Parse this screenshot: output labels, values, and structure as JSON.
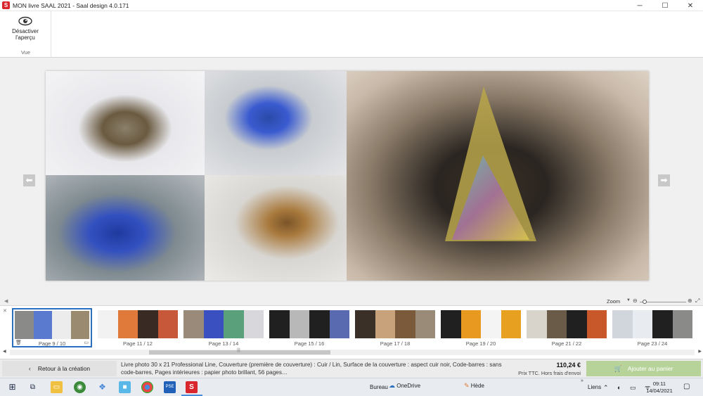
{
  "window": {
    "logo_letter": "S",
    "title": "MON livre SAAL 2021 - Saal design 4.0.171",
    "minimize": "─",
    "maximize": "☐",
    "close": "✕"
  },
  "ribbon": {
    "preview_label_line1": "Désactiver",
    "preview_label_line2": "l'aperçu",
    "group_label": "Vue"
  },
  "canvas": {
    "prev_arrow": "⬅",
    "next_arrow": "➡"
  },
  "zoom": {
    "label": "Zoom",
    "dropdown": "▼",
    "out_icon": "⊖",
    "in_icon": "⊕",
    "fit_icon": "⤢",
    "level": 0.1
  },
  "thumbnails": [
    {
      "label": "Page 9 / 10",
      "colors": [
        "#8a8a88",
        "#5a7ad0",
        "#ececec",
        "#9a8a70"
      ],
      "selected": true
    },
    {
      "label": "Page 11 / 12",
      "colors": [
        "#f2f2f2",
        "#e07a3a",
        "#3a2a24",
        "#c8583a"
      ],
      "selected": false
    },
    {
      "label": "Page 13 / 14",
      "colors": [
        "#9a8a7a",
        "#3a50c0",
        "#5aa07a",
        "#d8d8dc"
      ],
      "selected": false
    },
    {
      "label": "Page 15 / 16",
      "colors": [
        "#202020",
        "#b8b8b8",
        "#202020",
        "#5a6ab0"
      ],
      "selected": false
    },
    {
      "label": "Page 17 / 18",
      "colors": [
        "#3a3028",
        "#c8a27a",
        "#7a5a3a",
        "#9a8a78"
      ],
      "selected": false
    },
    {
      "label": "Page 19 / 20",
      "colors": [
        "#202020",
        "#e89a20",
        "#f4f4f4",
        "#e8a020"
      ],
      "selected": false
    },
    {
      "label": "Page 21 / 22",
      "colors": [
        "#d8d4cc",
        "#6a5a48",
        "#202020",
        "#c8582a"
      ],
      "selected": false
    },
    {
      "label": "Page 23 / 24",
      "colors": [
        "#d0d6dc",
        "#e8ecf0",
        "#202020",
        "#8a8a88"
      ],
      "selected": false
    }
  ],
  "strip": {
    "close_icon": "✕",
    "delete_icon": "🗑",
    "options_icon": "▭",
    "scroll_left": "◀",
    "scroll_right": "▶",
    "scroll_grip": "|||"
  },
  "footer": {
    "back_chevron": "‹",
    "back_label": "Retour à la création",
    "description": "Livre photo 30 x 21 Professional Line, Couverture (première de couverture) : Cuir / Lin, Surface de la couverture : aspect cuir noir, Code-barres : sans code-barres, Pages intérieures : papier photo brillant, 56 pages…",
    "price": "110,24 €",
    "price_note": "Prix TTC. Hors frais d'envoi",
    "cart_icon": "🛒",
    "add_to_cart": "Ajouter au panier"
  },
  "taskbar": {
    "start": "⊞",
    "taskview": "⧉",
    "explorer": "▭",
    "tripadvisor": "◉",
    "dropbox": "❖",
    "cube": "■",
    "chrome": "",
    "pse": "PSE",
    "saal": "S",
    "bureau": "Bureau",
    "onedrive_icon": "☁",
    "onedrive": "OneDrive",
    "hede_icon": "✎",
    "hede": "Hède",
    "chevron_up": "»",
    "liens": "Liens",
    "tray": "⌃ ◐ ▭ ᯤ",
    "time": "09:11",
    "date": "14/04/2021",
    "notifications": "▢"
  }
}
